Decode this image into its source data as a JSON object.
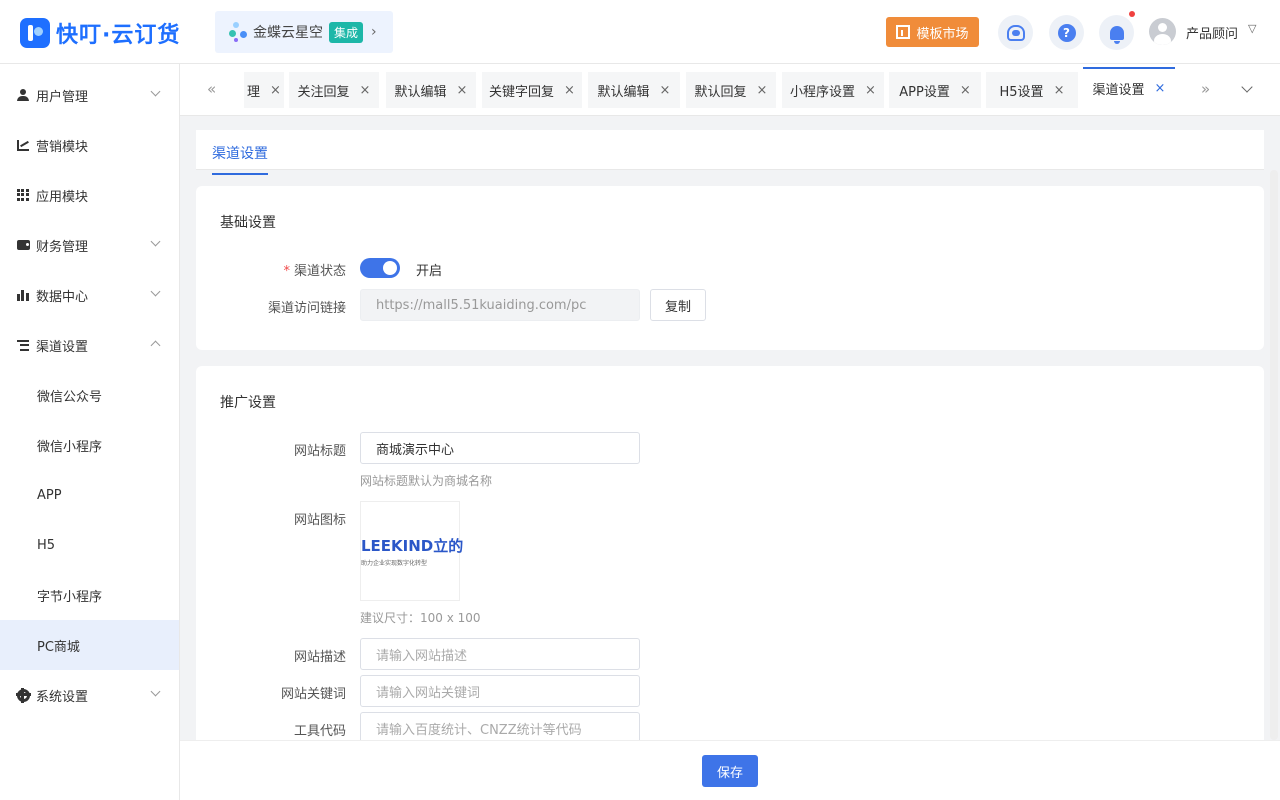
{
  "header": {
    "logo_text": "快叮·云订货",
    "brand_name": "金蝶云星空",
    "brand_badge": "集成",
    "market_label": "模板市场",
    "user_name": "产品顾问"
  },
  "sidebar": {
    "items": [
      {
        "label": "用户管理",
        "icon": "user-icon",
        "expandable": true
      },
      {
        "label": "营销模块",
        "icon": "chart-icon",
        "expandable": false
      },
      {
        "label": "应用模块",
        "icon": "grid-icon",
        "expandable": false
      },
      {
        "label": "财务管理",
        "icon": "wallet-icon",
        "expandable": true
      },
      {
        "label": "数据中心",
        "icon": "bar-chart-icon",
        "expandable": true
      },
      {
        "label": "渠道设置",
        "icon": "list-icon",
        "expandable": true,
        "expanded": true
      },
      {
        "label": "系统设置",
        "icon": "gear-icon",
        "expandable": true
      }
    ],
    "channel_subitems": [
      "微信公众号",
      "微信小程序",
      "APP",
      "H5",
      "字节小程序",
      "PC商城"
    ],
    "active_subitem": "PC商城"
  },
  "tabs": [
    {
      "label": "理"
    },
    {
      "label": "关注回复"
    },
    {
      "label": "默认编辑"
    },
    {
      "label": "关键字回复"
    },
    {
      "label": "默认编辑"
    },
    {
      "label": "默认回复"
    },
    {
      "label": "小程序设置"
    },
    {
      "label": "APP设置"
    },
    {
      "label": "H5设置"
    },
    {
      "label": "渠道设置",
      "active": true
    }
  ],
  "tab_nav": {
    "prev": "«",
    "next": "»",
    "close": "×"
  },
  "content_tab": "渠道设置",
  "basic": {
    "title": "基础设置",
    "status_label": "渠道状态",
    "required_mark": "*",
    "status_value": "开启",
    "status_on": true,
    "link_label": "渠道访问链接",
    "link_value": "https://mall5.51kuaiding.com/pc",
    "copy_label": "复制"
  },
  "promo": {
    "title": "推广设置",
    "site_title_label": "网站标题",
    "site_title_value": "商城演示中心",
    "site_title_hint": "网站标题默认为商城名称",
    "site_icon_label": "网站图标",
    "icon_logo_text": "LEEKIND立的",
    "icon_logo_sub": "助力企业实现数字化转型",
    "icon_hint": "建议尺寸：100 x 100",
    "desc_label": "网站描述",
    "desc_placeholder": "请输入网站描述",
    "keywords_label": "网站关键词",
    "keywords_placeholder": "请输入网站关键词",
    "tools_label": "工具代码",
    "tools_placeholder": "请输入百度统计、CNZZ统计等代码"
  },
  "footer": {
    "save_label": "保存"
  },
  "colors": {
    "primary": "#3e74e8",
    "market": "#f08c3a",
    "badge": "#1db7a8",
    "notice_dot": "#f0413f"
  }
}
